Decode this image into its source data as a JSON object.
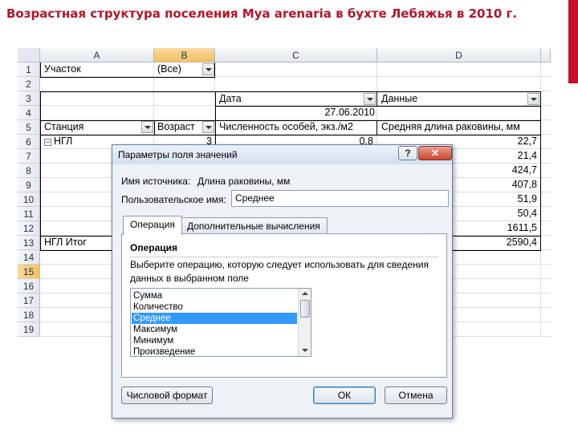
{
  "slide": {
    "title": "Возрастная структура поселения Mya arenaria в бухте Лебяжья в 2010 г.",
    "accent_color": "#c8102e",
    "title_color": "#b2162a"
  },
  "sheet": {
    "columns": [
      "A",
      "B",
      "C",
      "D"
    ],
    "rows": [
      "1",
      "2",
      "3",
      "4",
      "5",
      "6",
      "7",
      "8",
      "9",
      "10",
      "11",
      "12",
      "13",
      "14",
      "15",
      "16",
      "17",
      "18",
      "19"
    ],
    "selected_row": "15",
    "selected_col": "B",
    "filter_label": "Участок",
    "filter_value": "(Все)",
    "col_field_label": "Дата",
    "data_field_label": "Данные",
    "date_value": "27.06.2010",
    "row_labels": {
      "station": "Станция",
      "age": "Возраст",
      "count": "Численность особей, экз./м2",
      "length": "Средняя длина раковины, мм"
    },
    "group_name": "НГЛ",
    "expander": "−",
    "first_age": "3",
    "first_count": "0,8",
    "length_values": [
      "22,7",
      "21,4",
      "424,7",
      "407,8",
      "51,9",
      "50,4",
      "1611,5"
    ],
    "total_label": "НГЛ Итог",
    "total_value": "2590,4"
  },
  "dialog": {
    "title": "Параметры поля значений",
    "help": "?",
    "close": "✕",
    "source_label": "Имя источника:",
    "source_value": "Длина раковины, мм",
    "custom_name_label": "Пользовательское имя:",
    "custom_name_value": "Среднее",
    "tabs": [
      "Операция",
      "Дополнительные вычисления"
    ],
    "active_tab": 0,
    "operation_heading": "Операция",
    "operation_desc": "Выберите операцию, которую следует использовать для сведения данных в выбранном поле",
    "operations": [
      "Сумма",
      "Количество",
      "Среднее",
      "Максимум",
      "Минимум",
      "Произведение"
    ],
    "selected_operation": "Среднее",
    "number_format_button": "Числовой формат",
    "ok_button": "ОК",
    "cancel_button": "Отмена"
  }
}
